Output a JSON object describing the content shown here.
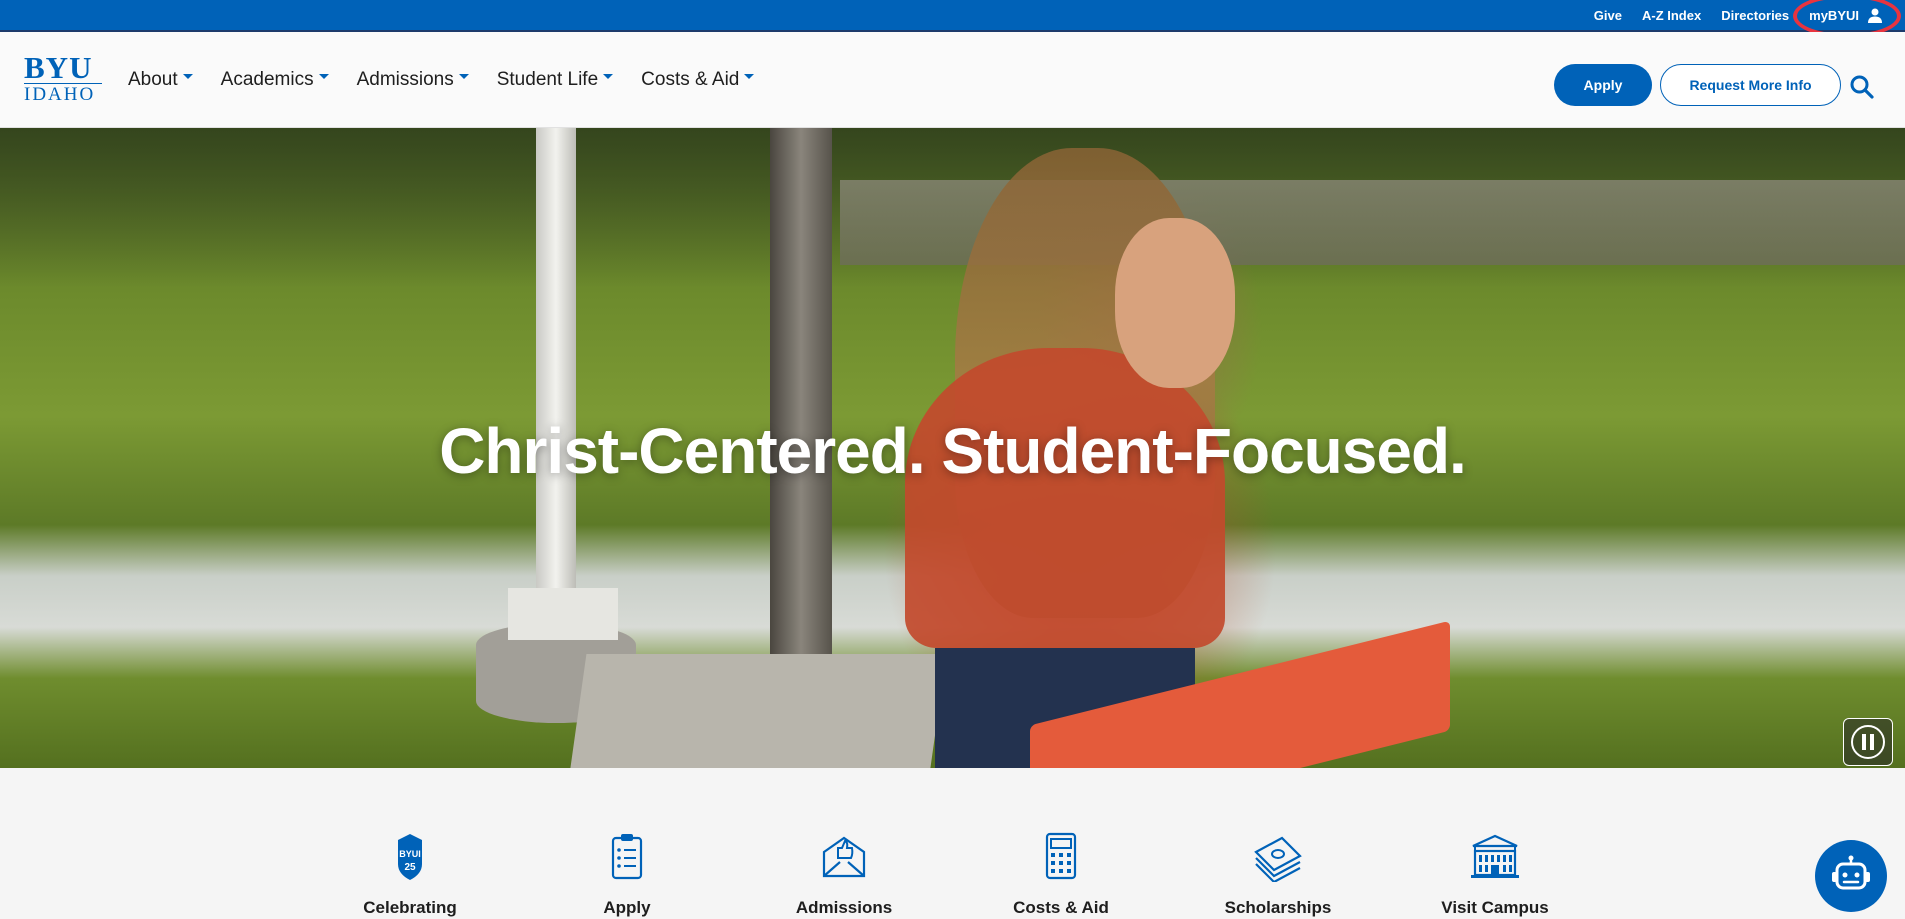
{
  "utility_bar": {
    "links": [
      "Give",
      "A-Z Index",
      "Directories"
    ],
    "mybyui_label": "myBYUI"
  },
  "logo": {
    "top": "BYU",
    "bottom": "IDAHO"
  },
  "nav": {
    "items": [
      "About",
      "Academics",
      "Admissions",
      "Student Life",
      "Costs & Aid"
    ]
  },
  "header_actions": {
    "apply_label": "Apply",
    "request_info_label": "Request More Info"
  },
  "hero": {
    "headline": "Christ-Centered. Student-Focused."
  },
  "quick_links": [
    {
      "label": "Celebrating",
      "icon": "byui-25-icon"
    },
    {
      "label": "Apply",
      "icon": "clipboard-icon"
    },
    {
      "label": "Admissions",
      "icon": "envelope-thumbs-up-icon"
    },
    {
      "label": "Costs & Aid",
      "icon": "calculator-icon"
    },
    {
      "label": "Scholarships",
      "icon": "money-stack-icon"
    },
    {
      "label": "Visit Campus",
      "icon": "building-icon"
    }
  ],
  "colors": {
    "brand_blue": "#0062b8",
    "highlight_ring": "#e8343f"
  },
  "badge": {
    "icon_text": "BYUI",
    "number": "25"
  }
}
